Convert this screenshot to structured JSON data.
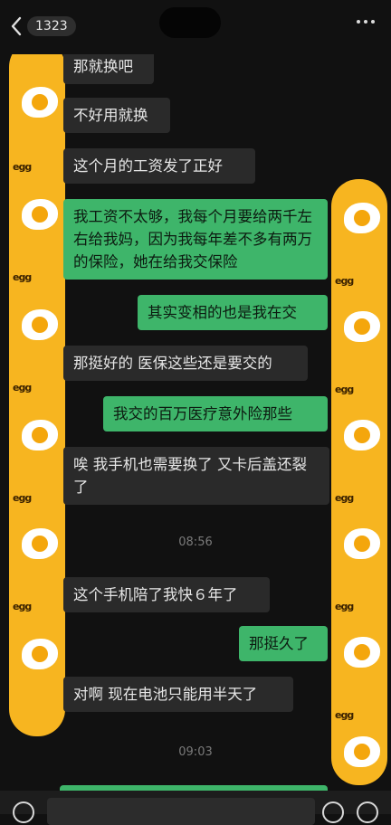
{
  "header": {
    "unread_count": "1323"
  },
  "messages": [
    {
      "side": "recv",
      "text": "那就换吧"
    },
    {
      "side": "recv",
      "text": "不好用就换"
    },
    {
      "side": "recv",
      "text": "这个月的工资发了正好"
    },
    {
      "side": "sent",
      "text": "我工资不太够，我每个月要给两千左右给我妈，因为我每年差不多有两万的保险，她在给我交保险"
    },
    {
      "side": "sent",
      "text": "其实变相的也是我在交"
    },
    {
      "side": "recv",
      "text": "那挺好的 医保这些还是要交的"
    },
    {
      "side": "sent",
      "text": "我交的百万医疗意外险那些"
    },
    {
      "side": "recv",
      "text": "唉 我手机也需要换了 又卡后盖还裂了"
    },
    {
      "side": "recv",
      "text": "这个手机陪了我快６年了"
    },
    {
      "side": "sent",
      "text": "那挺久了"
    },
    {
      "side": "recv",
      "text": "对啊 现在电池只能用半天了"
    }
  ],
  "timestamps": [
    "08:56",
    "09:03"
  ],
  "decor": {
    "cover_color": "#f7b520",
    "cover_pattern_text": "egg"
  },
  "colors": {
    "background": "#111111",
    "sent_bubble": "#3eb56a",
    "recv_bubble": "#2a2a2a"
  }
}
